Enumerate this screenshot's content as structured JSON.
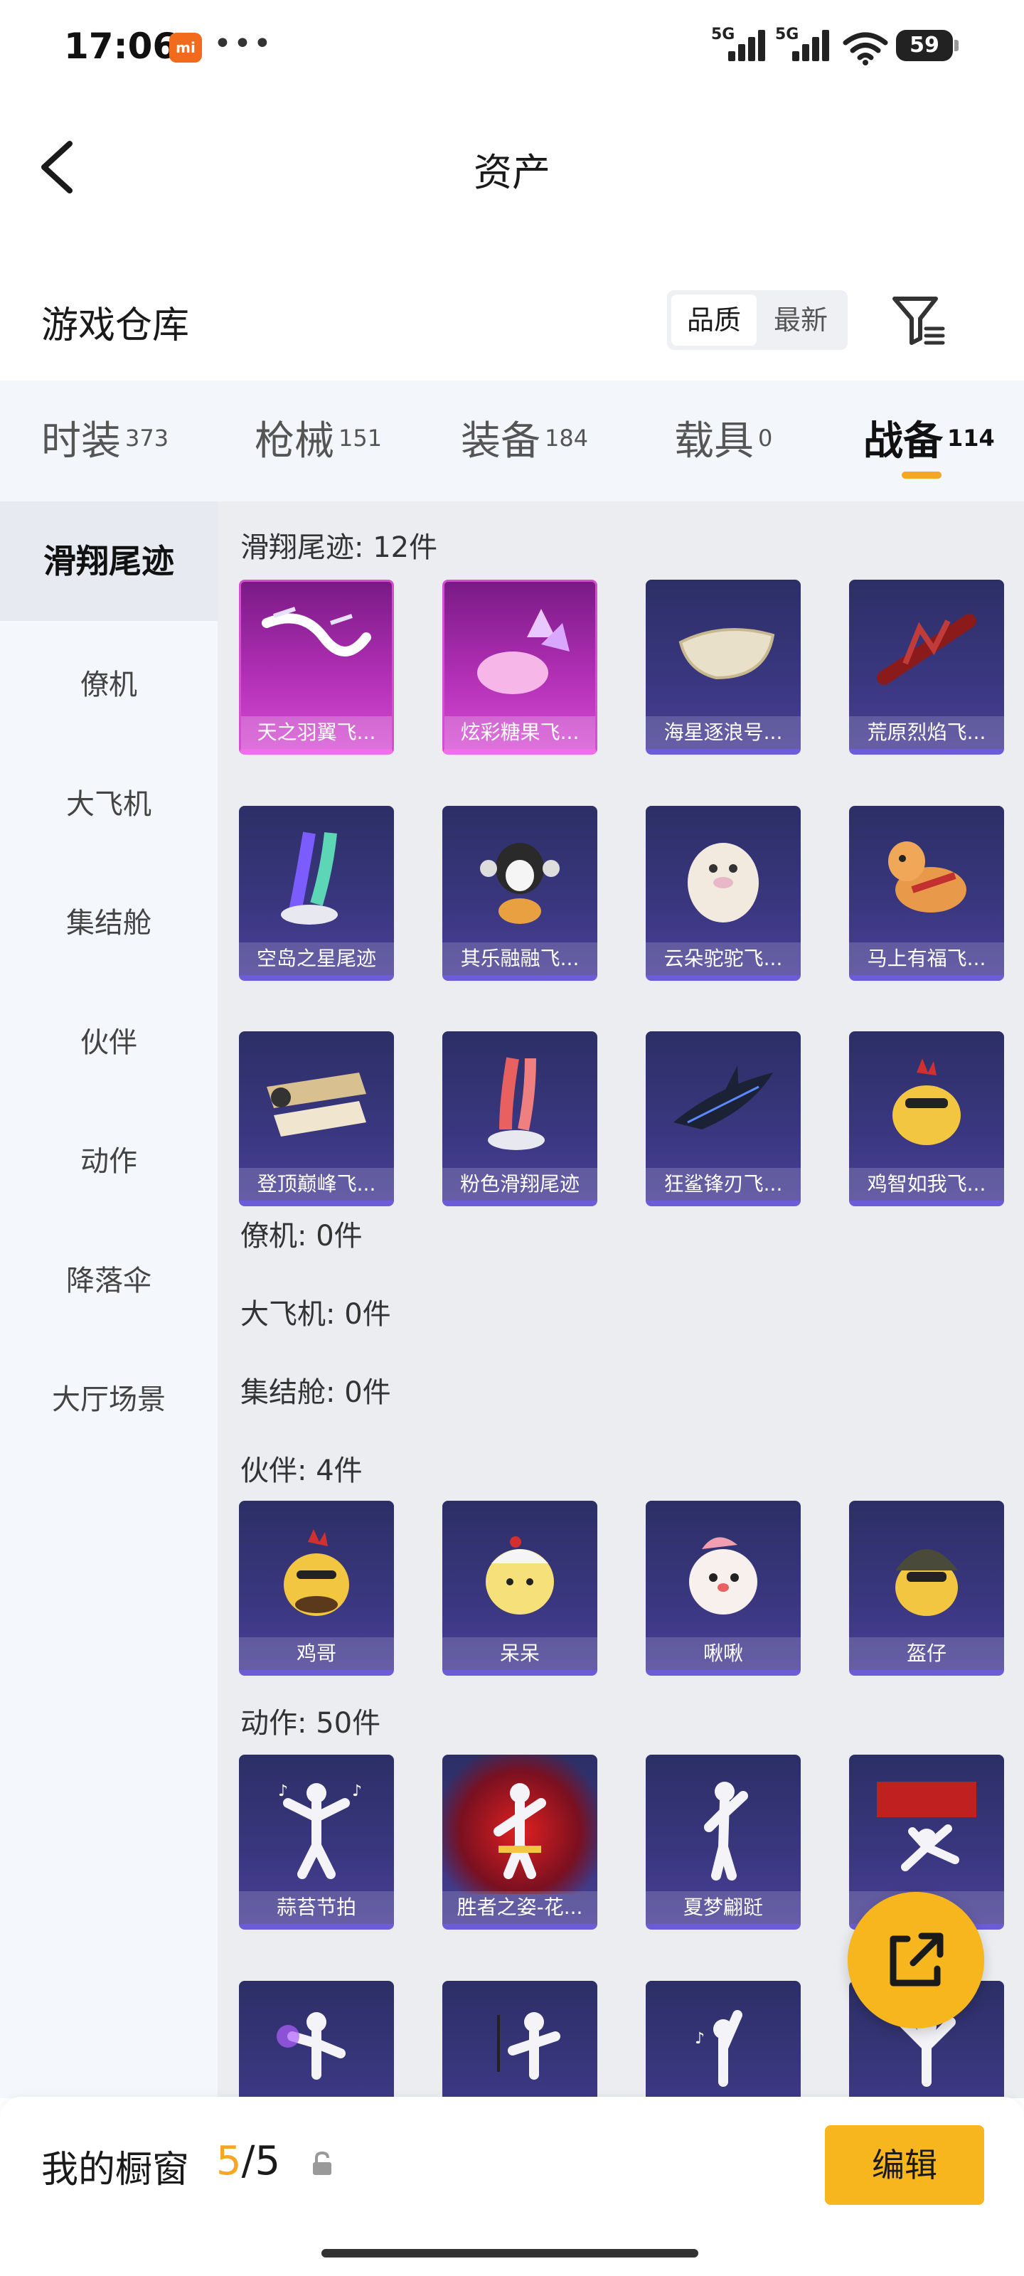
{
  "status_bar": {
    "time": "17:06",
    "brand_badge": "mi",
    "more_dots": "•••",
    "signal_1": "5G",
    "signal_2": "5G",
    "battery": "59"
  },
  "header": {
    "title": "资产"
  },
  "warehouse": {
    "title": "游戏仓库",
    "sort_options": [
      "品质",
      "最新"
    ],
    "active_sort": "品质"
  },
  "tabs": [
    {
      "label": "时装",
      "count": "373"
    },
    {
      "label": "枪械",
      "count": "151"
    },
    {
      "label": "装备",
      "count": "184"
    },
    {
      "label": "载具",
      "count": "0"
    },
    {
      "label": "战备",
      "count": "114"
    }
  ],
  "active_tab": "战备",
  "sidebar": {
    "items": [
      "滑翔尾迹",
      "僚机",
      "大飞机",
      "集结舱",
      "伙伴",
      "动作",
      "降落伞",
      "大厅场景"
    ],
    "active": "滑翔尾迹"
  },
  "sections": {
    "glide": {
      "title": "滑翔尾迹: 12件",
      "items": [
        {
          "name": "天之羽翼飞...",
          "icon": "wing-icon"
        },
        {
          "name": "炫彩糖果飞...",
          "icon": "candy-icon"
        },
        {
          "name": "海星逐浪号...",
          "icon": "boat-icon"
        },
        {
          "name": "荒原烈焰飞...",
          "icon": "flame-glider-icon"
        },
        {
          "name": "空岛之星尾迹",
          "icon": "rainbow-trail-icon"
        },
        {
          "name": "其乐融融飞...",
          "icon": "penguin-icon"
        },
        {
          "name": "云朵驼驼飞...",
          "icon": "alpaca-icon"
        },
        {
          "name": "马上有福飞...",
          "icon": "horse-icon"
        },
        {
          "name": "登顶巅峰飞...",
          "icon": "jet-icon"
        },
        {
          "name": "粉色滑翔尾迹",
          "icon": "pink-trail-icon"
        },
        {
          "name": "狂鲨锋刃飞...",
          "icon": "shark-icon"
        },
        {
          "name": "鸡智如我飞...",
          "icon": "chicken-glider-icon"
        }
      ]
    },
    "wingman": {
      "title": "僚机: 0件"
    },
    "plane": {
      "title": "大飞机: 0件"
    },
    "pod": {
      "title": "集结舱: 0件"
    },
    "partner": {
      "title": "伙伴: 4件",
      "items": [
        {
          "name": "鸡哥",
          "icon": "chicken-icon"
        },
        {
          "name": "呆呆",
          "icon": "chick-icon"
        },
        {
          "name": "啾啾",
          "icon": "bird-icon"
        },
        {
          "name": "盔仔",
          "icon": "helmet-chick-icon"
        }
      ]
    },
    "emote": {
      "title": "动作: 50件",
      "items": [
        {
          "name": "蒜苔节拍",
          "icon": "dance-icon"
        },
        {
          "name": "胜者之姿-花...",
          "icon": "victory-pose-icon"
        },
        {
          "name": "夏梦翩跹",
          "icon": "pose-icon"
        },
        {
          "name": "",
          "icon": "spider-pose-icon"
        },
        {
          "name": "",
          "icon": "pose-icon"
        },
        {
          "name": "",
          "icon": "pose-icon"
        },
        {
          "name": "",
          "icon": "pose-icon"
        },
        {
          "name": "",
          "icon": "pose-icon"
        }
      ]
    }
  },
  "bottom_bar": {
    "label": "我的橱窗",
    "current": "5",
    "separator": "/",
    "total": "5",
    "edit_label": "编辑"
  },
  "colors": {
    "accent": "#f7b51e",
    "card_base": "#2c2f66",
    "card_rare": "#b02fb4",
    "card_stripe": "#6d5cd8"
  }
}
